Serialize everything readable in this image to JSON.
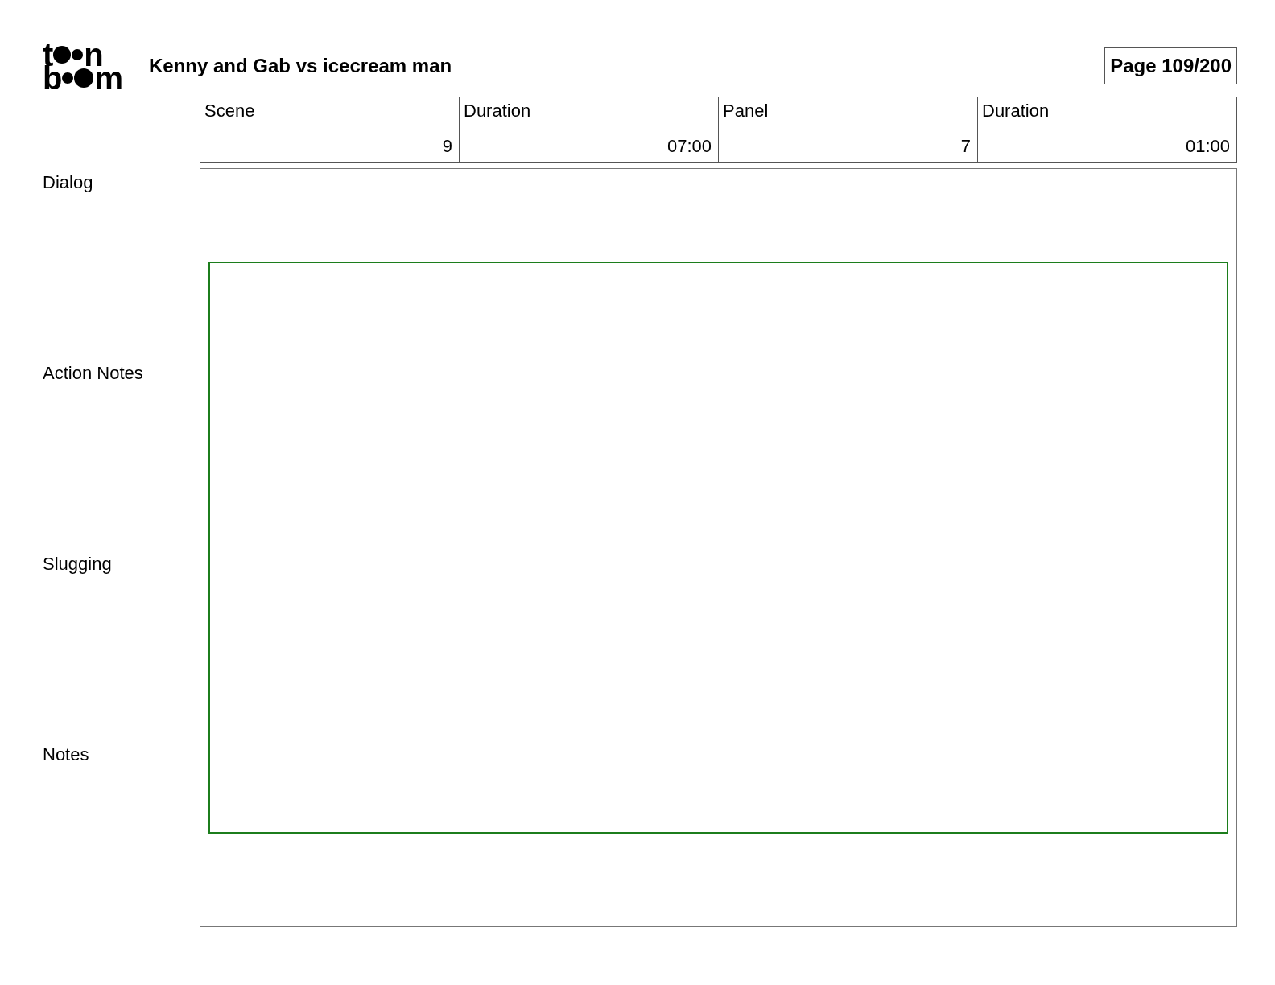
{
  "logo": {
    "top": [
      "t",
      "n"
    ],
    "bottom": [
      "b",
      "m"
    ]
  },
  "document": {
    "title": "Kenny and Gab vs icecream man",
    "page": "Page 109/200"
  },
  "info_table": {
    "columns": [
      "Scene",
      "Duration",
      "Panel",
      "Duration"
    ],
    "row": [
      "9",
      "07:00",
      "7",
      "01:00"
    ]
  },
  "sections": [
    "Dialog",
    "Action Notes",
    "Slugging",
    "Notes"
  ]
}
